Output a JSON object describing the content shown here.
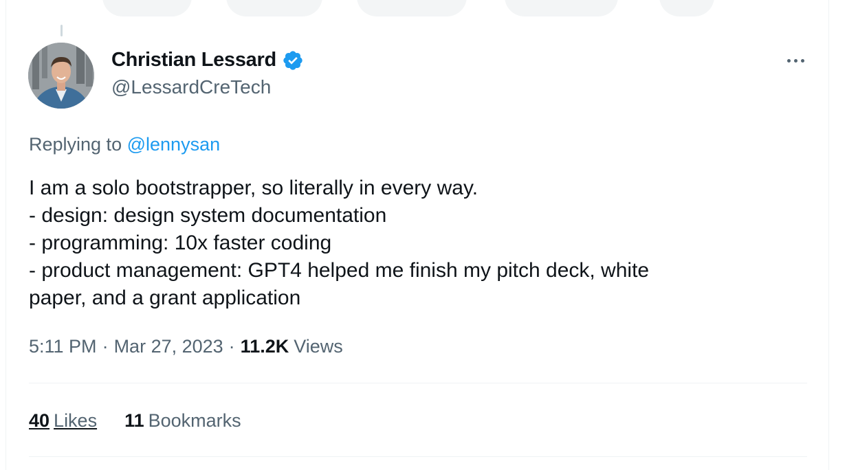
{
  "author": {
    "name": "Christian Lessard",
    "handle": "@LessardCreTech",
    "verified_icon": "verified-badge-icon",
    "verified_color": "#1d9bf0"
  },
  "reply": {
    "prefix": "Replying to",
    "mention": "@lennysan"
  },
  "tweet": {
    "lines": [
      "I am a solo bootstrapper, so literally in every way.",
      "- design: design system documentation",
      "- programming: 10x faster coding",
      "- product management: GPT4 helped me finish my pitch deck, white",
      "paper, and a grant application"
    ]
  },
  "meta": {
    "time": "5:11 PM",
    "separator": "·",
    "date": "Mar 27, 2023",
    "views_count": "11.2K",
    "views_label": "Views"
  },
  "stats": {
    "likes_count": "40",
    "likes_label": "Likes",
    "bookmarks_count": "11",
    "bookmarks_label": "Bookmarks"
  },
  "colors": {
    "link": "#1d9bf0",
    "secondary_text": "#536471",
    "primary_text": "#0f1419",
    "divider": "#eff3f4"
  },
  "more_icon": "more-horizontal-icon"
}
